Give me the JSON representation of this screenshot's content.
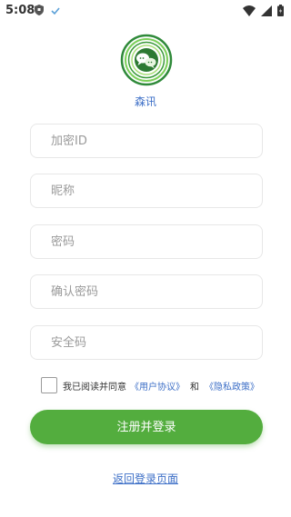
{
  "status_bar": {
    "time": "5:08",
    "icons": [
      "shield-icon",
      "check-icon",
      "wifi-icon",
      "signal-icon",
      "battery-icon"
    ]
  },
  "app": {
    "name": "森讯",
    "logo_icon": "chat-bubbles-logo",
    "brand_green": "#53ad3e"
  },
  "form": {
    "fields": [
      {
        "placeholder": "加密ID",
        "value": ""
      },
      {
        "placeholder": "昵称",
        "value": ""
      },
      {
        "placeholder": "密码",
        "value": ""
      },
      {
        "placeholder": "确认密码",
        "value": ""
      },
      {
        "placeholder": "安全码",
        "value": ""
      }
    ]
  },
  "agreement": {
    "checked": false,
    "prefix": "我已阅读并同意",
    "user_agreement": "《用户协议》",
    "and": "和",
    "privacy_policy": "《隐私政策》"
  },
  "actions": {
    "register_button": "注册并登录",
    "back_link": "返回登录页面"
  },
  "colors": {
    "link_blue": "#3d6fc7",
    "border": "#e7e7e7"
  }
}
